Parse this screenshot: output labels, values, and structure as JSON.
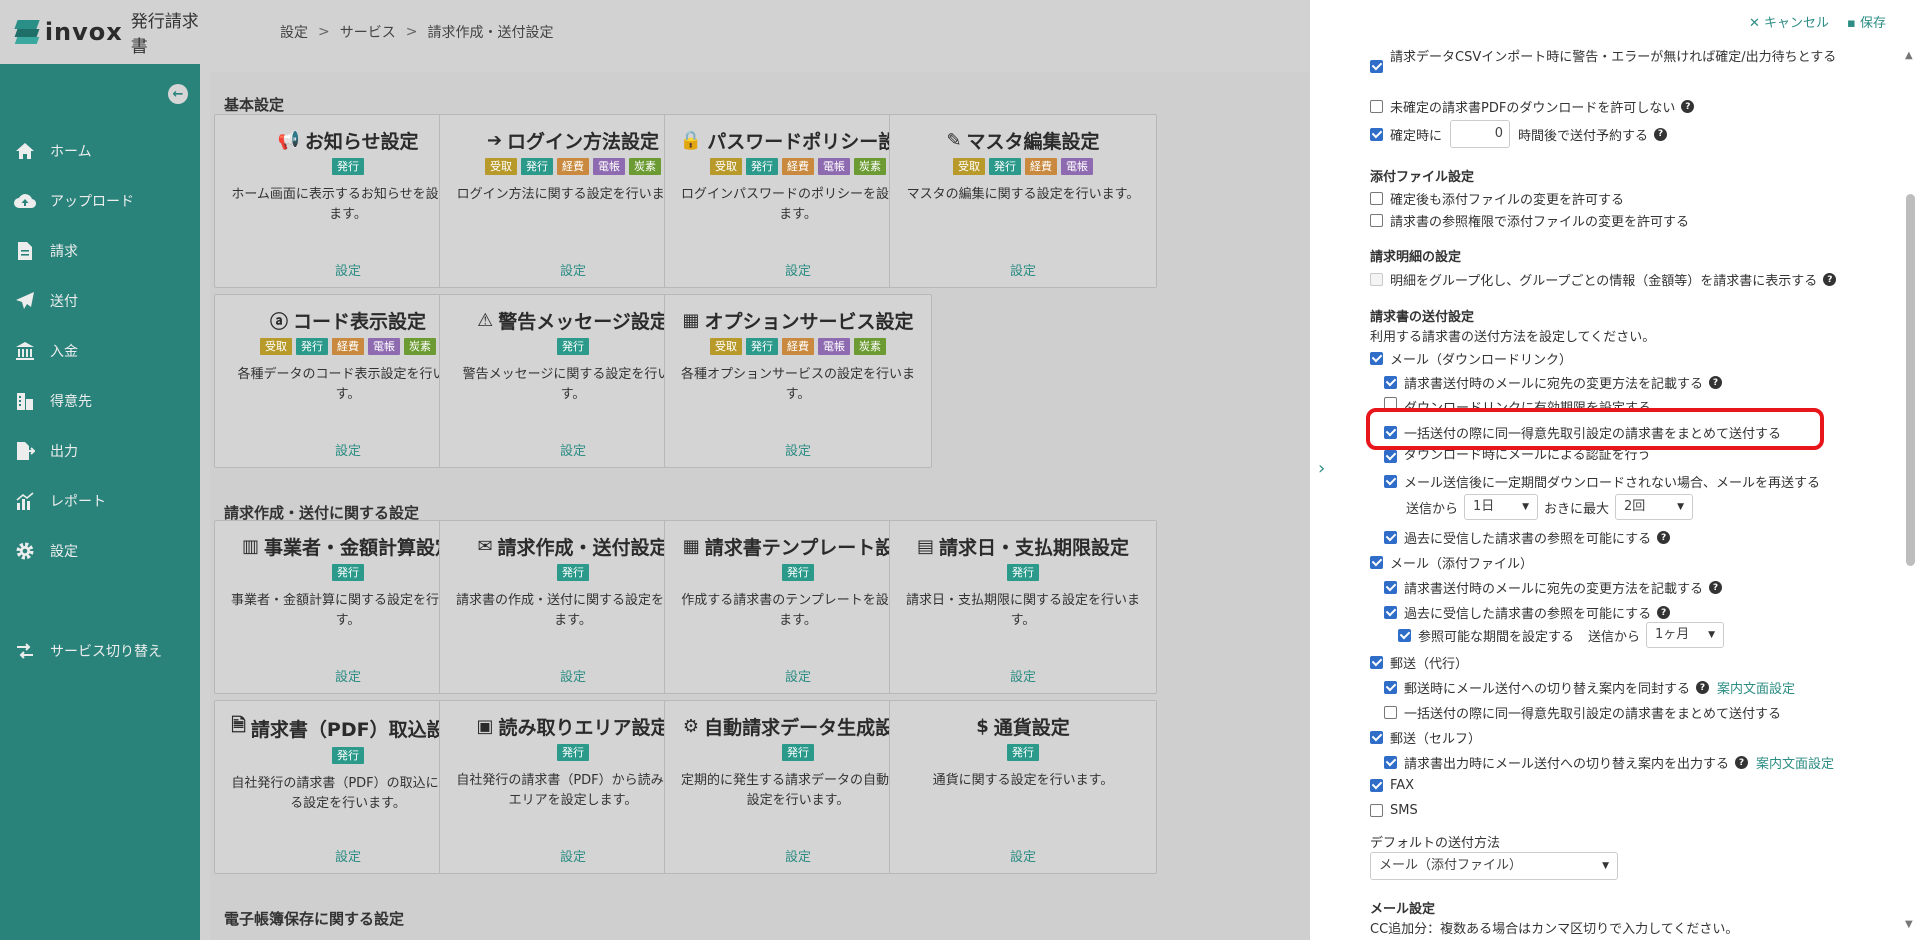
{
  "app": {
    "brand": "invox",
    "subtitle": "発行請求書"
  },
  "breadcrumb": [
    "設定",
    "サービス",
    "請求作成・送付設定"
  ],
  "sidebar": {
    "items": [
      {
        "label": "ホーム",
        "icon": "home-icon"
      },
      {
        "label": "アップロード",
        "icon": "cloud-upload-icon"
      },
      {
        "label": "請求",
        "icon": "document-icon"
      },
      {
        "label": "送付",
        "icon": "paper-plane-icon"
      },
      {
        "label": "入金",
        "icon": "bank-icon"
      },
      {
        "label": "得意先",
        "icon": "building-icon"
      },
      {
        "label": "出力",
        "icon": "export-icon"
      },
      {
        "label": "レポート",
        "icon": "chart-icon"
      },
      {
        "label": "設定",
        "icon": "gear-icon"
      }
    ],
    "service_switch": "サービス切り替え"
  },
  "sections": {
    "basic": "基本設定",
    "invoice": "請求作成・送付に関する設定",
    "ledger": "電子帳簿保存に関する設定"
  },
  "tag_labels": {
    "recv": "受取",
    "issue": "発行",
    "exp": "経費",
    "elec": "電帳",
    "carbon": "炭素"
  },
  "cards": [
    {
      "title": "お知らせ設定",
      "icon": "megaphone-icon",
      "glyph": "📢",
      "tags": [
        "issue"
      ],
      "desc": "ホーム画面に表示するお知らせを設定します。",
      "link": "設定"
    },
    {
      "title": "ログイン方法設定",
      "icon": "login-icon",
      "glyph": "➔",
      "tags": [
        "recv",
        "issue",
        "exp",
        "elec",
        "carbon"
      ],
      "desc": "ログイン方法に関する設定を行います。",
      "link": "設定"
    },
    {
      "title": "パスワードポリシー設定",
      "icon": "lock-icon",
      "glyph": "🔒",
      "tags": [
        "recv",
        "issue",
        "exp",
        "elec",
        "carbon"
      ],
      "desc": "ログインパスワードのポリシーを設定します。",
      "link": "設定"
    },
    {
      "title": "マスタ編集設定",
      "icon": "edit-icon",
      "glyph": "✎",
      "tags": [
        "recv",
        "issue",
        "exp",
        "elec"
      ],
      "desc": "マスタの編集に関する設定を行います。",
      "link": "設定"
    },
    {
      "title": "コード表示設定",
      "icon": "abc-icon",
      "glyph": "ⓐ",
      "tags": [
        "recv",
        "issue",
        "exp",
        "elec",
        "carbon"
      ],
      "desc": "各種データのコード表示設定を行います。",
      "link": "設定"
    },
    {
      "title": "警告メッセージ設定",
      "icon": "warning-icon",
      "glyph": "⚠",
      "tags": [
        "issue"
      ],
      "desc": "警告メッセージに関する設定を行います。",
      "link": "設定"
    },
    {
      "title": "オプションサービス設定",
      "icon": "grid-plus-icon",
      "glyph": "▦",
      "tags": [
        "recv",
        "issue",
        "exp",
        "elec",
        "carbon"
      ],
      "desc": "各種オプションサービスの設定を行います。",
      "link": "設定"
    },
    {
      "title": "事業者・金額計算設定",
      "icon": "building-icon",
      "glyph": "▥",
      "tags": [
        "issue"
      ],
      "desc": "事業者・金額計算に関する設定を行います。",
      "link": "設定"
    },
    {
      "title": "請求作成・送付設定",
      "icon": "invoice-send-icon",
      "glyph": "✉",
      "tags": [
        "issue"
      ],
      "desc": "請求書の作成・送付に関する設定を行います。",
      "link": "設定"
    },
    {
      "title": "請求書テンプレート設定",
      "icon": "template-icon",
      "glyph": "▦",
      "tags": [
        "issue"
      ],
      "desc": "作成する請求書のテンプレートを設定します。",
      "link": "設定"
    },
    {
      "title": "請求日・支払期限設定",
      "icon": "calendar-icon",
      "glyph": "▤",
      "tags": [
        "issue"
      ],
      "desc": "請求日・支払期限に関する設定を行います。",
      "link": "設定"
    },
    {
      "title": "請求書（PDF）取込設定",
      "icon": "file-import-icon",
      "glyph": "🗎",
      "tags": [
        "issue"
      ],
      "desc": "自社発行の請求書（PDF）の取込に関する設定を行います。",
      "link": "設定"
    },
    {
      "title": "読み取りエリア設定",
      "icon": "scan-area-icon",
      "glyph": "▣",
      "tags": [
        "issue"
      ],
      "desc": "自社発行の請求書（PDF）から読み取るエリアを設定します。",
      "link": "設定"
    },
    {
      "title": "自動請求データ生成設定",
      "icon": "cog-icon",
      "glyph": "⚙",
      "tags": [
        "issue"
      ],
      "desc": "定期的に発生する請求データの自動生成設定を行います。",
      "link": "設定"
    },
    {
      "title": "通貨設定",
      "icon": "dollar-icon",
      "glyph": "$",
      "tags": [
        "issue"
      ],
      "desc": "通貨に関する設定を行います。",
      "link": "設定"
    }
  ],
  "drawer": {
    "cancel": "キャンセル",
    "save": "保存",
    "csv_warn": "請求データCSVインポート時に警告・エラーが無ければ確定/出力待ちとする",
    "allow_pdf": "未確定の請求書PDFのダウンロードを許可しない",
    "confirm_prefix": "確定時に",
    "confirm_hours": "0",
    "confirm_suffix": "時間後で送付予約する",
    "attach_title": "添付ファイル設定",
    "attach_1": "確定後も添付ファイルの変更を許可する",
    "attach_2": "請求書の参照権限で添付ファイルの変更を許可する",
    "detail_title": "請求明細の設定",
    "detail_1": "明細をグループ化し、グループごとの情報（金額等）を請求書に表示する",
    "send_title": "請求書の送付設定",
    "send_desc": "利用する請求書の送付方法を設定してください。",
    "mail_dl": "メール（ダウンロードリンク）",
    "mail_dl_1": "請求書送付時のメールに宛先の変更方法を記載する",
    "mail_dl_2": "ダウンロードリンクに有効期限を設定する",
    "mail_dl_3": "一括送付の際に同一得意先取引設定の請求書をまとめて送付する",
    "mail_dl_4": "ダウンロード時にメールによる認証を行う",
    "mail_dl_5": "メール送信後に一定期間ダウンロードされない場合、メールを再送する",
    "resend_from": "送信から",
    "resend_interval": "1日",
    "resend_mid": "おきに最大",
    "resend_count": "2回",
    "mail_dl_6": "過去に受信した請求書の参照を可能にする",
    "mail_att": "メール（添付ファイル）",
    "mail_att_1": "請求書送付時のメールに宛先の変更方法を記載する",
    "mail_att_2": "過去に受信した請求書の参照を可能にする",
    "mail_att_3": "参照可能な期間を設定する",
    "ref_from": "送信から",
    "ref_period": "1ヶ月",
    "post_agent": "郵送（代行）",
    "post_agent_1": "郵送時にメール送付への切り替え案内を同封する",
    "post_agent_link": "案内文面設定",
    "post_agent_2": "一括送付の際に同一得意先取引設定の請求書をまとめて送付する",
    "post_self": "郵送（セルフ）",
    "post_self_1": "請求書出力時にメール送付への切り替え案内を出力する",
    "post_self_link": "案内文面設定",
    "fax": "FAX",
    "sms": "SMS",
    "default_label": "デフォルトの送付方法",
    "default_value": "メール（添付ファイル）",
    "mail_settings_title": "メール設定",
    "cc_desc": "CC追加分：複数ある場合はカンマ区切りで入力してください。"
  }
}
